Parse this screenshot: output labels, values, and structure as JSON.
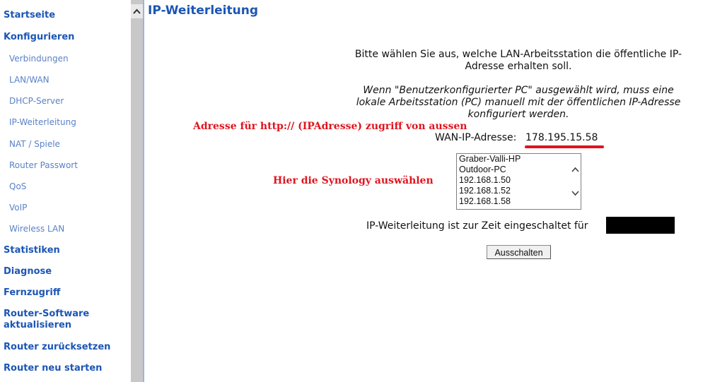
{
  "sidebar": {
    "items": [
      {
        "label": "Startseite",
        "level": "main"
      },
      {
        "label": "Konfigurieren",
        "level": "main"
      },
      {
        "label": "Verbindungen",
        "level": "sub"
      },
      {
        "label": "LAN/WAN",
        "level": "sub"
      },
      {
        "label": "DHCP-Server",
        "level": "sub"
      },
      {
        "label": "IP-Weiterleitung",
        "level": "sub"
      },
      {
        "label": "NAT / Spiele",
        "level": "sub"
      },
      {
        "label": "Router Passwort",
        "level": "sub"
      },
      {
        "label": "QoS",
        "level": "sub"
      },
      {
        "label": "VoIP",
        "level": "sub"
      },
      {
        "label": "Wireless LAN",
        "level": "sub"
      },
      {
        "label": "Statistiken",
        "level": "main"
      },
      {
        "label": "Diagnose",
        "level": "main"
      },
      {
        "label": "Fernzugriff",
        "level": "main"
      },
      {
        "label_line1": "Router-Software",
        "label_line2": "aktualisieren",
        "level": "main"
      },
      {
        "label": "Router zurücksetzen",
        "level": "main"
      },
      {
        "label": "Router neu starten",
        "level": "main"
      }
    ]
  },
  "page": {
    "title": "IP-Weiterleitung",
    "intro_line1": "Bitte wählen Sie aus, welche LAN-Arbeitsstation die öffentliche IP-",
    "intro_line2": "Adresse erhalten soll.",
    "note_line1": "Wenn \"Benutzerkonfigurierter PC\" ausgewählt wird, muss eine",
    "note_line2": "lokale Arbeitsstation (PC) manuell mit der öffentlichen IP-Adresse",
    "note_line3": "konfiguriert werden.",
    "wan_label": "WAN-IP-Adresse:",
    "wan_ip": "178.195.15.58",
    "pc_list": [
      "Graber-Valli-HP",
      "Outdoor-PC",
      "192.168.1.50",
      "192.168.1.52",
      "192.168.1.58"
    ],
    "status_text": "IP-Weiterleitung ist zur Zeit eingeschaltet für",
    "button_label": "Ausschalten"
  },
  "annotations": {
    "address_note": "Adresse für http:// (IPAdresse) zugriff von aussen",
    "select_note": "Hier die Synology auswählen",
    "color": "#e0141e"
  },
  "colors": {
    "nav_main": "#1c56b5",
    "nav_sub": "#5a82c7",
    "title": "#1c56b5"
  }
}
